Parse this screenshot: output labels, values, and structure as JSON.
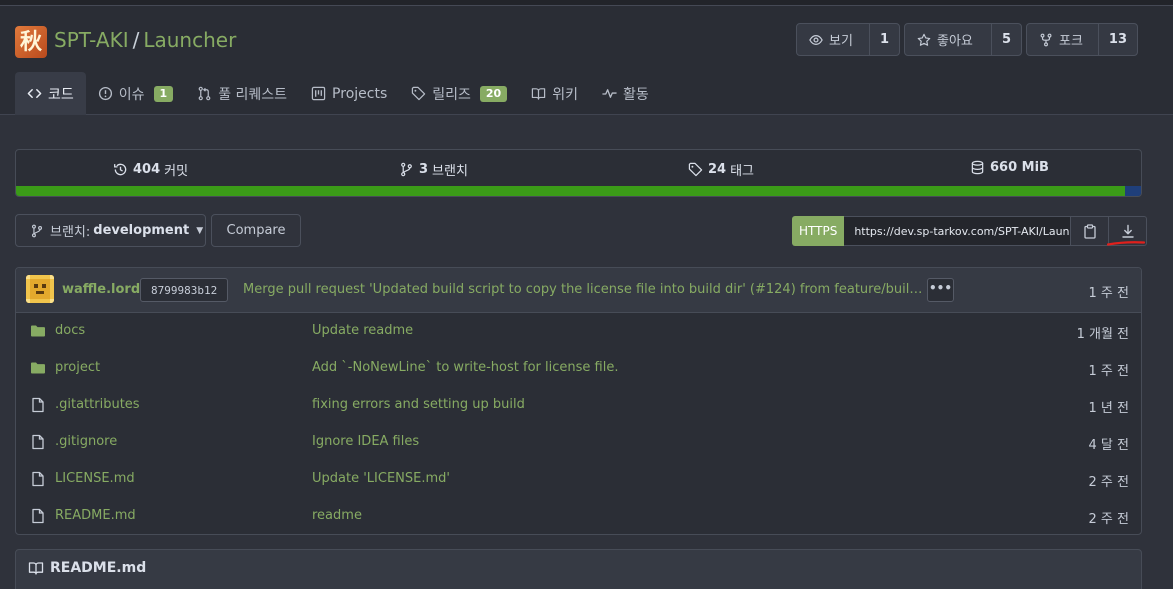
{
  "repo": {
    "owner": "SPT-AKI",
    "separator": "/",
    "name": "Launcher",
    "logo_char": "秋"
  },
  "actions": {
    "watch": {
      "label": "보기",
      "count": "1"
    },
    "star": {
      "label": "좋아요",
      "count": "5"
    },
    "fork": {
      "label": "포크",
      "count": "13"
    }
  },
  "tabs": [
    {
      "label": "코드",
      "icon": "code-icon",
      "active": true
    },
    {
      "label": "이슈",
      "icon": "issue-icon",
      "badge": "1"
    },
    {
      "label": "풀 리퀘스트",
      "icon": "pull-request-icon"
    },
    {
      "label": "Projects",
      "icon": "project-icon"
    },
    {
      "label": "릴리즈",
      "icon": "tag-icon",
      "badge": "20"
    },
    {
      "label": "위키",
      "icon": "book-icon"
    },
    {
      "label": "활동",
      "icon": "pulse-icon"
    }
  ],
  "stats": {
    "commits": {
      "value": "404",
      "label": "커밋"
    },
    "branches": {
      "value": "3",
      "label": "브랜치"
    },
    "tags": {
      "value": "24",
      "label": "태그"
    },
    "size": {
      "value": "660 MiB"
    },
    "language_share": 0.986
  },
  "branch": {
    "prefix": "브랜치:",
    "name": "development",
    "compare_label": "Compare"
  },
  "clone": {
    "protocol": "HTTPS",
    "url": "https://dev.sp-tarkov.com/SPT-AKI/Launcher.git"
  },
  "latest_commit": {
    "author": "waffle.lord",
    "sha": "8799983b12",
    "message": "Merge pull request 'Updated build script to copy the license file into build dir' (#124) from feature/build-script-license-file into development",
    "ellipsis": "•••",
    "time": "1 주 전"
  },
  "files": [
    {
      "name": "docs",
      "type": "folder",
      "message": "Update readme",
      "time": "1 개월 전"
    },
    {
      "name": "project",
      "type": "folder",
      "message": "Add `-NoNewLine` to write-host for license file.",
      "time": "1 주 전"
    },
    {
      "name": ".gitattributes",
      "type": "file",
      "message": "fixing errors and setting up build",
      "time": "1 년 전"
    },
    {
      "name": ".gitignore",
      "type": "file",
      "message": "Ignore IDEA files",
      "time": "4 달 전"
    },
    {
      "name": "LICENSE.md",
      "type": "file",
      "message": "Update 'LICENSE.md'",
      "time": "2 주 전"
    },
    {
      "name": "README.md",
      "type": "file",
      "message": "readme",
      "time": "2 주 전"
    }
  ],
  "readme": {
    "title": "README.md"
  },
  "colors": {
    "accent": "#87ab63",
    "background": "#2f323b",
    "language_bar": "#3b9b18",
    "annotation": "#e0201c"
  }
}
